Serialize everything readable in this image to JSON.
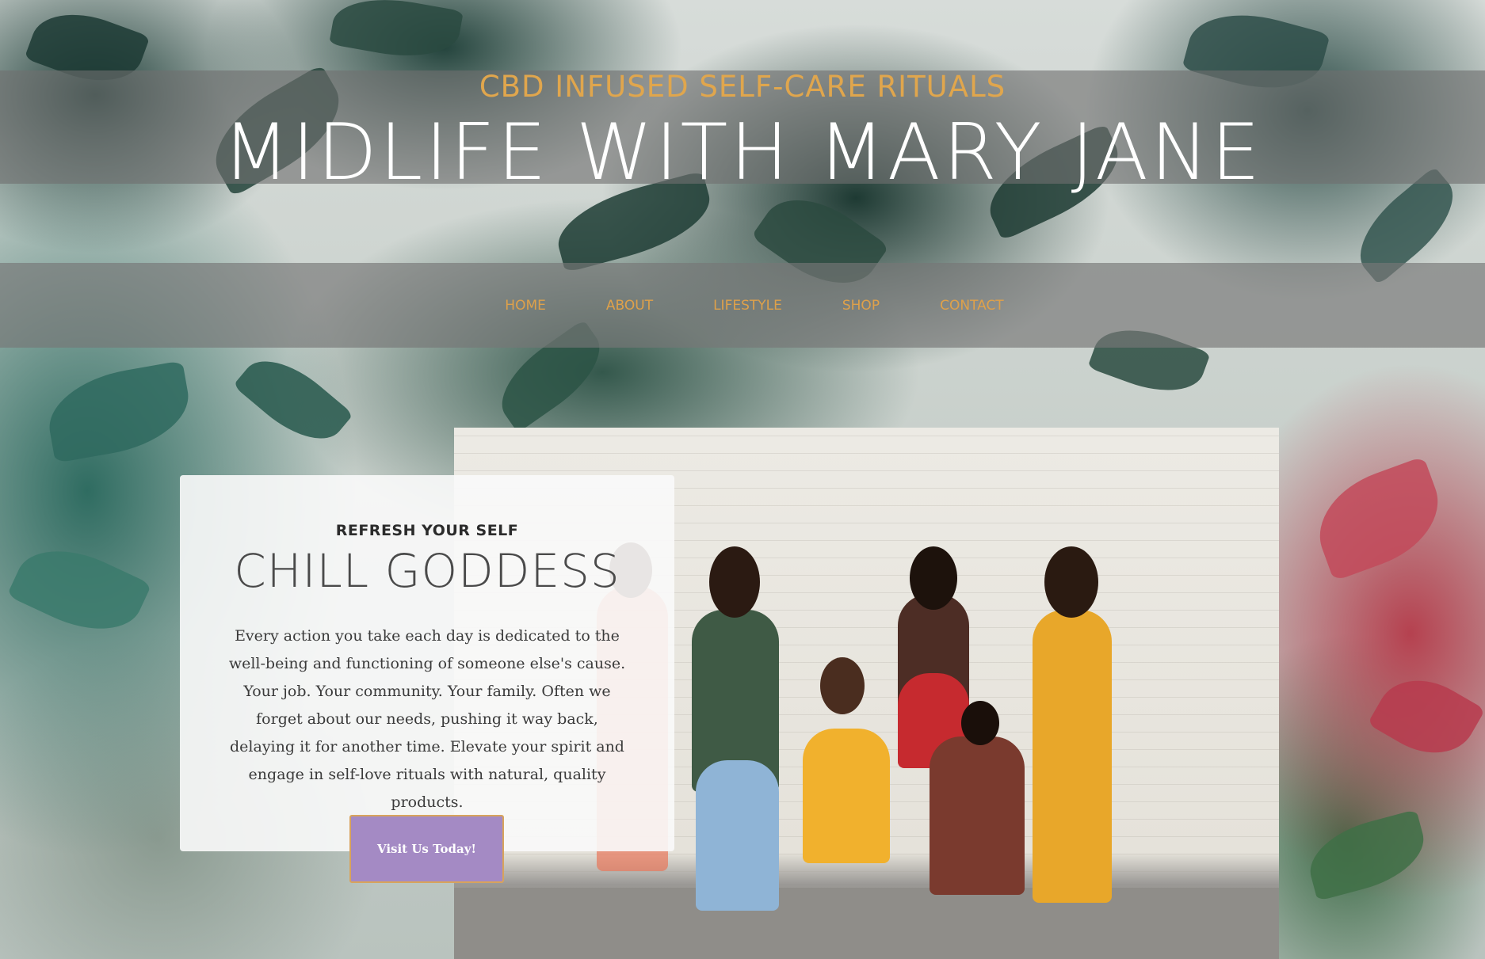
{
  "header": {
    "tagline": "CBD INFUSED SELF-CARE RITUALS",
    "site_title": "MIDLIFE WITH MARY JANE"
  },
  "nav": {
    "items": [
      {
        "label": "HOME"
      },
      {
        "label": "ABOUT"
      },
      {
        "label": "LIFESTYLE"
      },
      {
        "label": "SHOP"
      },
      {
        "label": "CONTACT"
      }
    ]
  },
  "hero": {
    "eyebrow": "REFRESH YOUR SELF",
    "heading": "CHILL GODDESS",
    "body": "Every action you take each day is dedicated to the well-being and functioning of someone else's cause. Your job. Your community. Your family. Often we forget about our needs, pushing it way back, delaying it for another time. Elevate your spirit and engage in self-love rituals with natural, quality products.",
    "cta_label": "Visit Us Today!"
  },
  "colors": {
    "accent_gold": "#e0a64d",
    "button_purple": "#a48ac4",
    "band_gray": "#707070"
  }
}
